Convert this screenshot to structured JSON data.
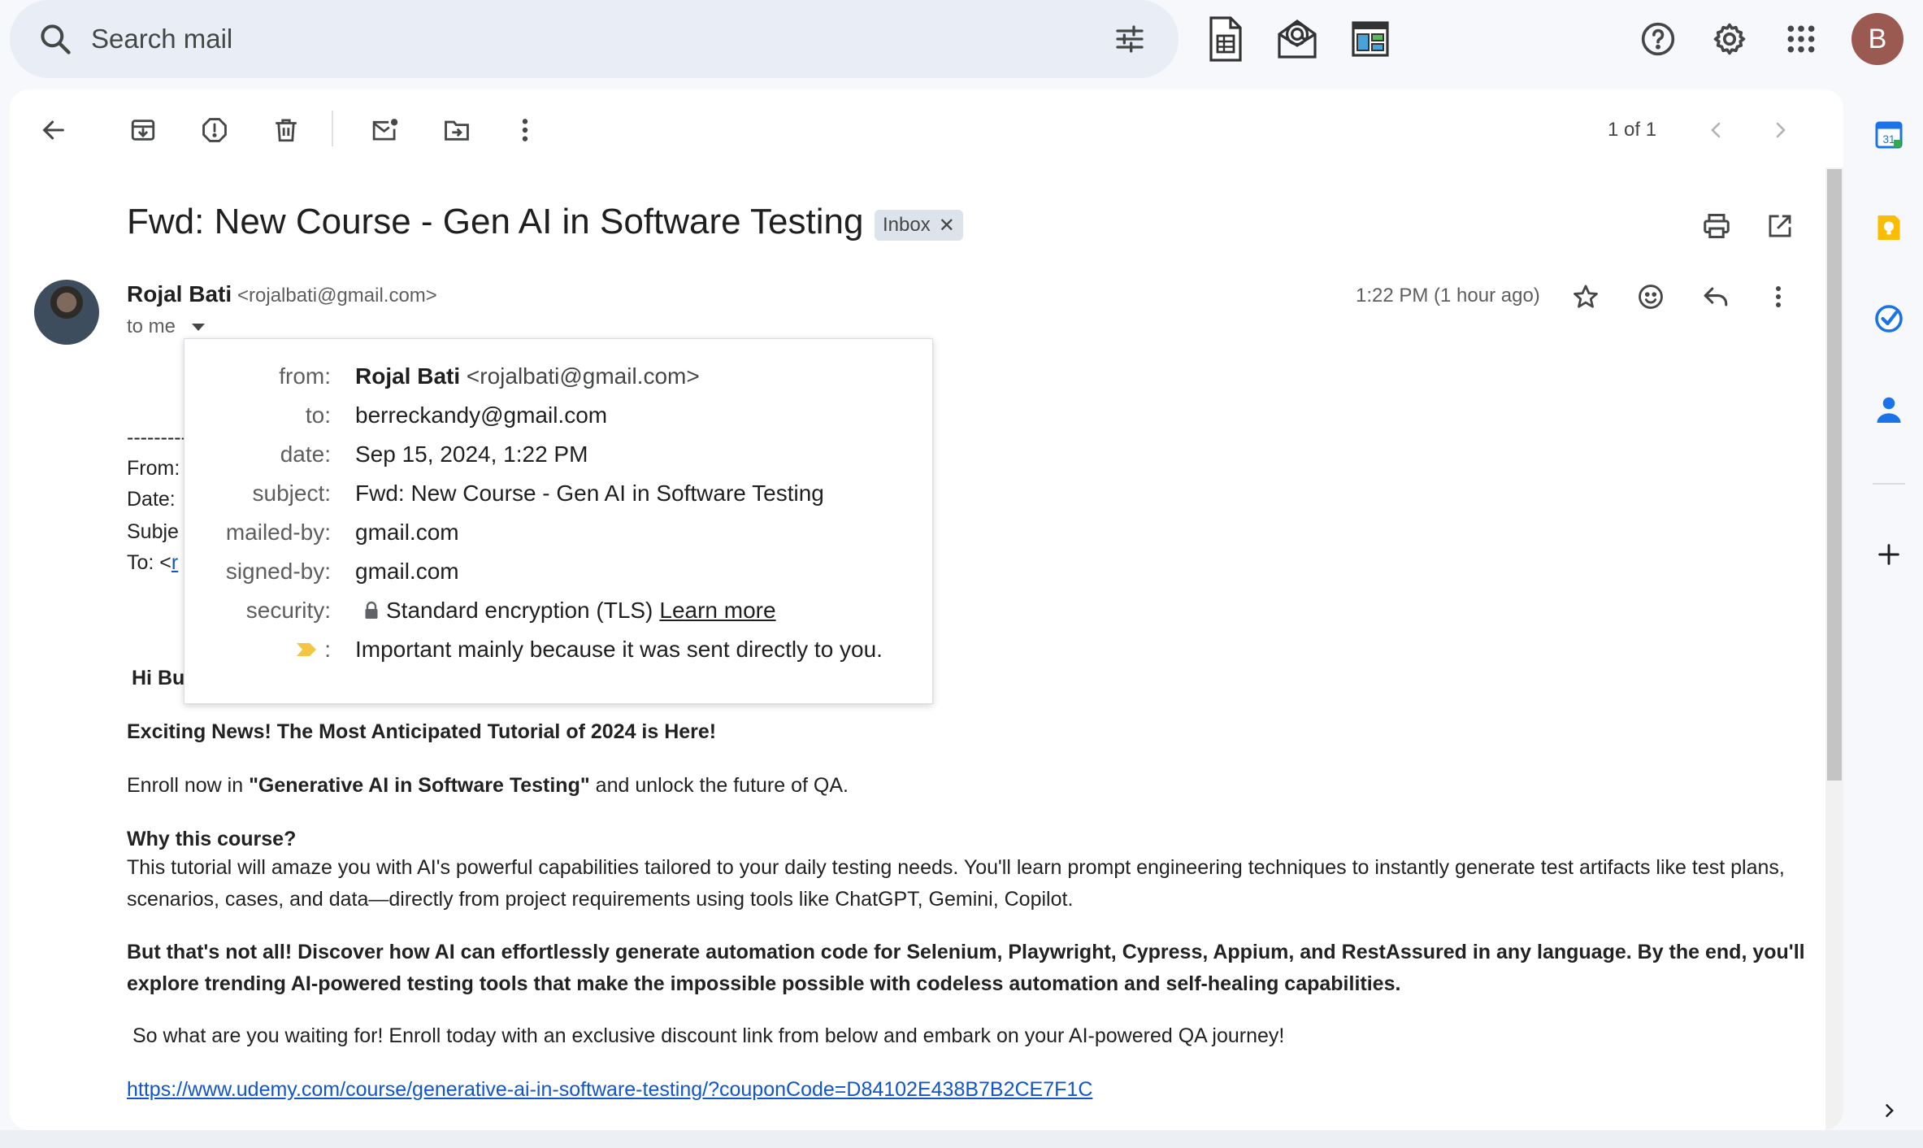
{
  "search": {
    "placeholder": "Search mail"
  },
  "account": {
    "initial": "B"
  },
  "toolbar": {
    "pager": "1 of 1"
  },
  "email": {
    "subject": "Fwd: New Course - Gen AI in Software Testing",
    "label_chip": "Inbox",
    "sender_name": "Rojal Bati",
    "sender_email": "<rojalbati@gmail.com>",
    "to_me": "to me",
    "timestamp": "1:22 PM (1 hour ago)"
  },
  "forwarded": {
    "separator": "---------",
    "from": "From:",
    "date": "Date:",
    "subject": "Subje",
    "to": "To: <",
    "to_link": "r"
  },
  "body": {
    "greeting": "Hi Bu",
    "headline": "Exciting News! The Most Anticipated Tutorial of 2024 is Here!",
    "enroll_pre": "Enroll now in ",
    "enroll_course": "\"Generative AI in Software Testing\"",
    "enroll_post": " and unlock the future of QA.",
    "why_heading": "Why this course?",
    "why_text": "This tutorial will amaze you with AI's powerful capabilities tailored to your daily testing needs. You'll learn prompt engineering techniques to instantly generate test artifacts like test plans, scenarios, cases, and data—directly from project requirements using tools like ChatGPT, Gemini, Copilot.",
    "more_text": "But that's not all! Discover how AI can effortlessly generate automation code for Selenium, Playwright, Cypress, Appium, and RestAssured in any language. By the end, you'll explore trending AI-powered testing tools that make the impossible possible with codeless automation and self-healing capabilities.",
    "cta_text": " So what are you waiting for! Enroll today with an exclusive discount link from below and embark on your AI-powered QA journey!",
    "course_link": "https://www.udemy.com/course/generative-ai-in-software-testing/?couponCode=D84102E438B7B2CE7F1C"
  },
  "details_popup": {
    "from_label": "from:",
    "from_name": "Rojal Bati",
    "from_email": "<rojalbati@gmail.com>",
    "to_label": "to:",
    "to_value": "berreckandy@gmail.com",
    "date_label": "date:",
    "date_value": "Sep 15, 2024, 1:22 PM",
    "subject_label": "subject:",
    "subject_value": "Fwd: New Course - Gen AI in Software Testing",
    "mailedby_label": "mailed-by:",
    "mailedby_value": "gmail.com",
    "signedby_label": "signed-by:",
    "signedby_value": "gmail.com",
    "security_label": "security:",
    "security_value": "Standard encryption (TLS)",
    "security_link": "Learn more",
    "importance_colon": ":",
    "importance_value": "Important mainly because it was sent directly to you."
  },
  "colors": {
    "accent_blue": "#1155cc",
    "avatar_bg": "#9a5a52",
    "importance_yellow": "#f4c542",
    "calendar_blue": "#1a73e8",
    "keep_yellow": "#fbbc04"
  }
}
